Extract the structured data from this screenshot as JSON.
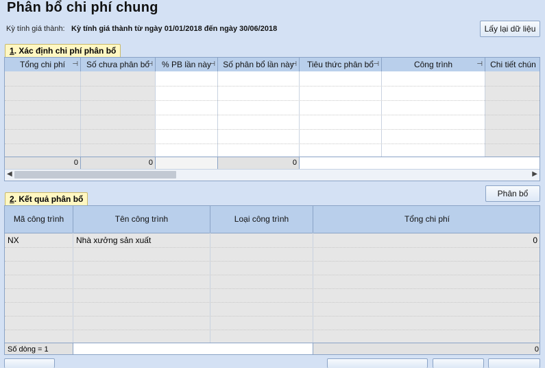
{
  "page": {
    "title": "Phân bổ chi phí chung",
    "period_label": "Kỳ tính giá thành:",
    "period_value": "Kỳ tính giá thành từ ngày 01/01/2018 đến ngày 30/06/2018",
    "reload_button": "Lấy lại dữ liệu"
  },
  "section1": {
    "tab_number": "1",
    "tab_title": ". Xác định chi phí phân bổ",
    "columns": [
      "Tổng chi phí",
      "Số chưa phân bổ",
      "% PB lần này",
      "Số phân bổ lần này",
      "Tiêu thức phân bổ",
      "Công trình",
      "Chi tiết chún"
    ],
    "totals": [
      "0",
      "0",
      "",
      "0",
      ""
    ]
  },
  "section2": {
    "tab_number": "2",
    "tab_title": ". Kết quả phân bổ",
    "allocate_button": "Phân bổ",
    "columns": [
      "Mã công trình",
      "Tên công trình",
      "Loại công trình",
      "Tổng chi phí"
    ],
    "rows": [
      {
        "code": "NX",
        "name": "Nhà xưởng sản xuất",
        "type": "",
        "total": "0"
      }
    ],
    "row_count": "Số dòng = 1",
    "footer_total": "0"
  },
  "icons": {
    "pin": "pin-icon",
    "scroll_left": "arrow-left-icon",
    "scroll_right": "arrow-right-icon"
  }
}
